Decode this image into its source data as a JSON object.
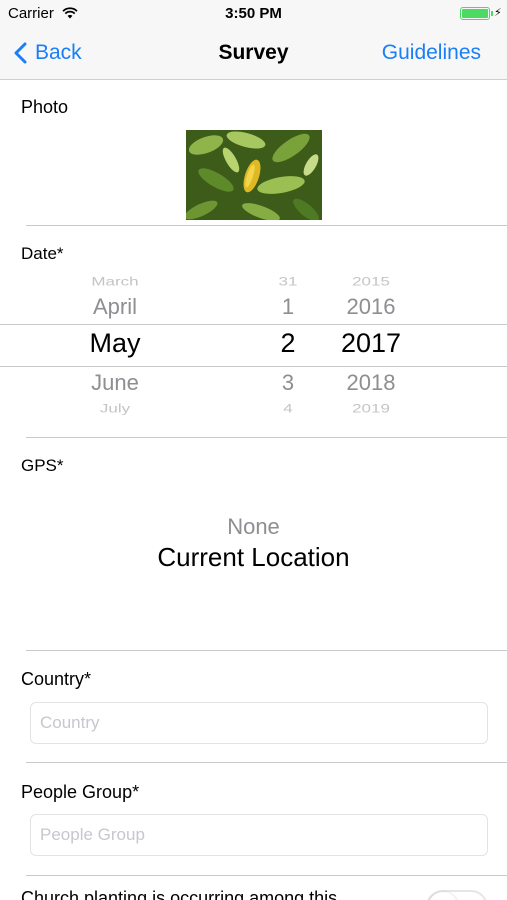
{
  "status_bar": {
    "carrier": "Carrier",
    "time": "3:50 PM",
    "battery_level": 1.0,
    "battery_color": "#4cd964"
  },
  "nav": {
    "back_label": "Back",
    "title": "Survey",
    "right_label": "Guidelines",
    "accent_color": "#1a7ff6"
  },
  "form": {
    "photo_label": "Photo",
    "date_label": "Date*",
    "date_picker": {
      "months": [
        "March",
        "April",
        "May",
        "June",
        "July"
      ],
      "days": [
        "31",
        "1",
        "2",
        "3",
        "4"
      ],
      "years": [
        "2015",
        "2016",
        "2017",
        "2018",
        "2019"
      ],
      "selected": {
        "month": "May",
        "day": "2",
        "year": "2017"
      }
    },
    "gps_label": "GPS*",
    "gps_options": [
      "None",
      "Current Location"
    ],
    "gps_selected": "Current Location",
    "country_label": "Country*",
    "country_placeholder": "Country",
    "country_value": "",
    "people_group_label": "People Group*",
    "people_group_placeholder": "People Group",
    "people_group_value": "",
    "church_planting_label": "Church planting is occurring among this",
    "church_planting_toggle": false
  }
}
